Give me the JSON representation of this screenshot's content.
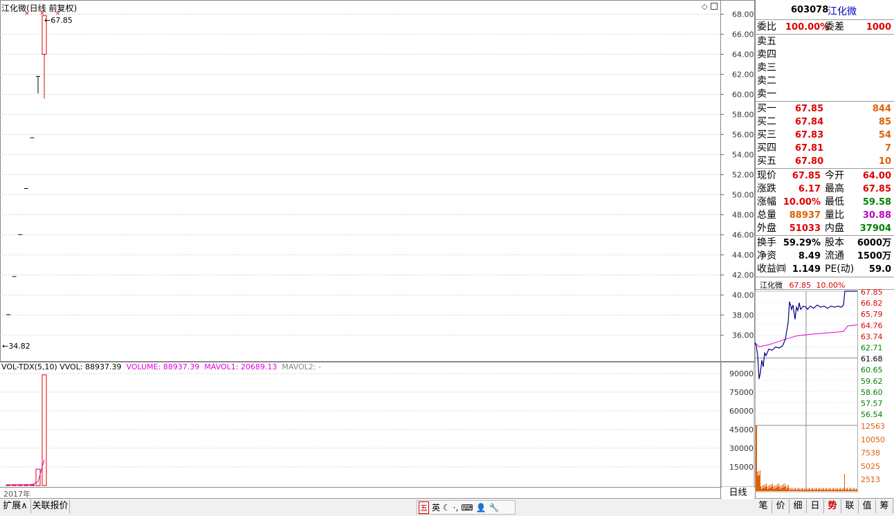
{
  "kline": {
    "title": "江化微(日线 前复权)",
    "markers": "× × ×",
    "high_label": "67.85",
    "low_label": "34.82",
    "y_ticks": [
      "68.00",
      "66.00",
      "64.00",
      "62.00",
      "60.00",
      "58.00",
      "56.00",
      "54.00",
      "52.00",
      "50.00",
      "48.00",
      "46.00",
      "44.00",
      "42.00",
      "40.00",
      "38.00",
      "36.00"
    ],
    "y_range": [
      34.0,
      68.0
    ],
    "candles": [
      {
        "o": 38.04,
        "h": 38.04,
        "l": 38.04,
        "c": 38.04
      },
      {
        "o": 41.84,
        "h": 41.84,
        "l": 41.84,
        "c": 41.84
      },
      {
        "o": 46.02,
        "h": 46.02,
        "l": 46.02,
        "c": 46.02
      },
      {
        "o": 50.62,
        "h": 50.62,
        "l": 50.62,
        "c": 50.62
      },
      {
        "o": 55.68,
        "h": 55.68,
        "l": 55.68,
        "c": 55.68
      },
      {
        "o": 61.25,
        "h": 61.8,
        "l": 60.1,
        "c": 61.8
      },
      {
        "o": 64.0,
        "h": 67.85,
        "l": 59.58,
        "c": 67.85
      }
    ]
  },
  "volume": {
    "header_name": "VOL-TDX(5,10)",
    "header_vvol": "VVOL: 88937.39",
    "header_volume": "VOLUME: 88937.39",
    "header_mavol1": "MAVOL1: 20689.13",
    "header_mavol2": "MAVOL2: -",
    "y_ticks": [
      "90000",
      "75000",
      "60000",
      "45000",
      "30000",
      "15000"
    ],
    "y_max": 90000,
    "values": [
      600,
      650,
      700,
      700,
      750,
      13200,
      88937
    ],
    "date_label": "2017年"
  },
  "quote": {
    "code": "603078",
    "name": "江化微",
    "weibi_label": "委比",
    "weibi_value": "100.00%",
    "weicha_label": "委差",
    "weicha_value": "1000",
    "sells": [
      {
        "label": "卖五"
      },
      {
        "label": "卖四"
      },
      {
        "label": "卖三"
      },
      {
        "label": "卖二"
      },
      {
        "label": "卖一"
      }
    ],
    "buys": [
      {
        "label": "买一",
        "price": "67.85",
        "vol": "844"
      },
      {
        "label": "买二",
        "price": "67.84",
        "vol": "85"
      },
      {
        "label": "买三",
        "price": "67.83",
        "vol": "54"
      },
      {
        "label": "买四",
        "price": "67.81",
        "vol": "7"
      },
      {
        "label": "买五",
        "price": "67.80",
        "vol": "10"
      }
    ],
    "stats1": [
      {
        "l1": "现价",
        "v1": "67.85",
        "l2": "今开",
        "v2": "64.00"
      },
      {
        "l1": "涨跌",
        "v1": "6.17",
        "l2": "最高",
        "v2": "67.85"
      },
      {
        "l1": "涨幅",
        "v1": "10.00%",
        "l2": "最低",
        "v2": "59.58"
      },
      {
        "l1": "总量",
        "v1": "88937",
        "l2": "量比",
        "v2": "30.88"
      },
      {
        "l1": "外盘",
        "v1": "51033",
        "l2": "内盘",
        "v2": "37904"
      }
    ],
    "stats2": [
      {
        "l1": "换手",
        "v1": "59.29%",
        "l2": "股本",
        "v2": "6000万"
      },
      {
        "l1": "净资",
        "v1": "8.49",
        "l2": "流通",
        "v2": "1500万"
      },
      {
        "l1": "收益㈣",
        "v1": "1.149",
        "l2": "PE(动)",
        "v2": "59.0"
      }
    ]
  },
  "mini": {
    "name": "江化微",
    "price": "67.85",
    "pct": "10.00%",
    "price_ticks": [
      "67.85",
      "66.82",
      "65.79",
      "64.76",
      "63.74",
      "62.71",
      "61.68",
      "60.65",
      "59.62",
      "58.60",
      "57.57",
      "56.54"
    ],
    "vol_ticks": [
      "12563",
      "10050",
      "7538",
      "5025",
      "2513"
    ],
    "price_range": [
      56.54,
      67.85
    ]
  },
  "bottom": {
    "period": "日线",
    "left_tabs": [
      "扩展∧",
      "关联报价"
    ],
    "ime": [
      "五",
      "英",
      "☾",
      "·,",
      "⌨",
      "👤",
      "🔧"
    ],
    "right_tabs": [
      "笔",
      "价",
      "细",
      "日",
      "势",
      "联",
      "值",
      "筹"
    ]
  },
  "colors": {
    "up": "#e00000",
    "down": "#008000",
    "ma": "#e000e0",
    "orange": "#e06000",
    "blue": "#0000c0"
  }
}
